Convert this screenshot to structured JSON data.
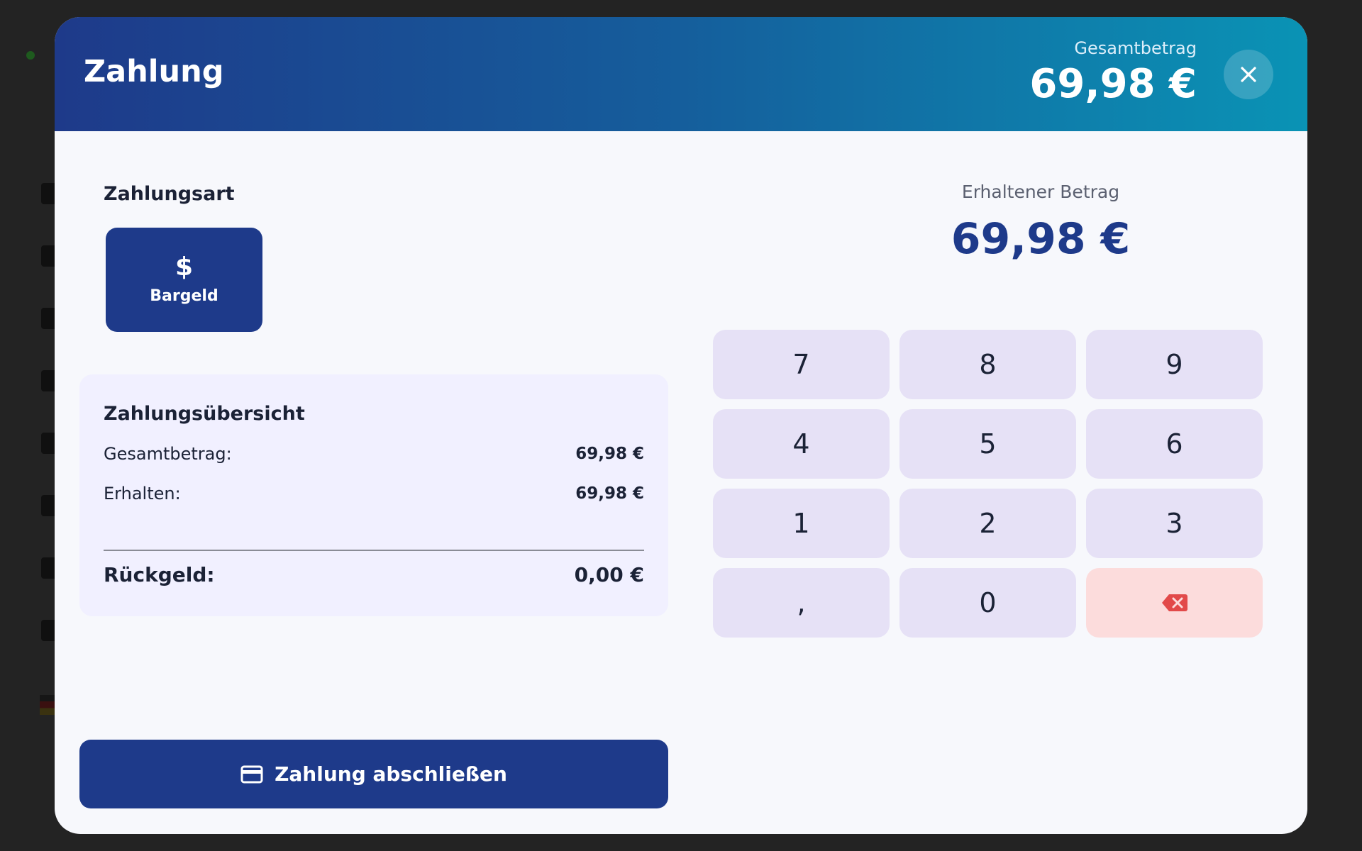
{
  "modal": {
    "title": "Zahlung",
    "total_label": "Gesamtbetrag",
    "total_value": "69,98 €",
    "close_icon": "close-icon"
  },
  "payment_method": {
    "section_label": "Zahlungsart",
    "selected": {
      "label": "Bargeld",
      "icon": "dollar-icon"
    }
  },
  "summary": {
    "title": "Zahlungsübersicht",
    "rows": [
      {
        "label": "Gesamtbetrag:",
        "value": "69,98 €"
      },
      {
        "label": "Erhalten:",
        "value": "69,98 €"
      }
    ],
    "change_label": "Rückgeld:",
    "change_value": "0,00 €"
  },
  "received": {
    "label": "Erhaltener Betrag",
    "value": "69,98 €"
  },
  "keypad": {
    "keys": [
      "7",
      "8",
      "9",
      "4",
      "5",
      "6",
      "1",
      "2",
      "3",
      ",",
      "0"
    ],
    "backspace_icon": "backspace-icon"
  },
  "complete_button": {
    "label": "Zahlung abschließen",
    "icon": "credit-card-icon"
  },
  "colors": {
    "primary": "#1e3a8a",
    "header_gradient_end": "#0a93b5",
    "keypad_key": "#e6e1f6",
    "delete_key": "#fcdcdc",
    "delete_icon": "#e24a4a",
    "summary_background": "#f1f0ff"
  }
}
